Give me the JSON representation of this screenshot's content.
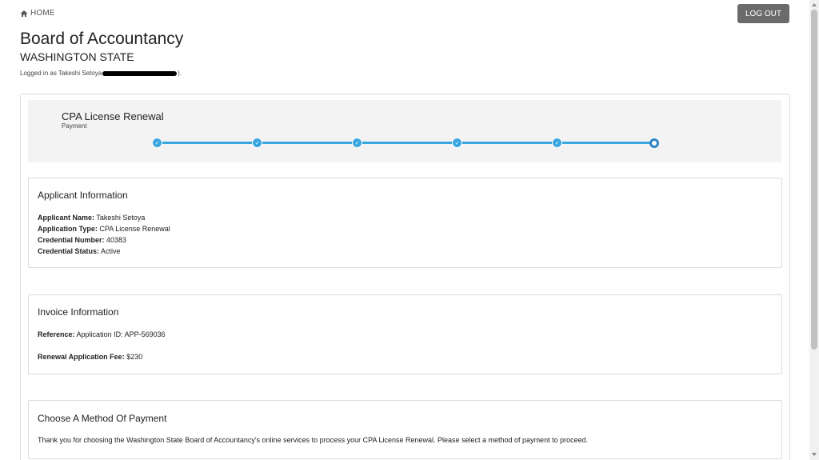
{
  "nav": {
    "home_label": "HOME",
    "logout_label": "LOG OUT"
  },
  "header": {
    "title": "Board of Accountancy",
    "subtitle": "WASHINGTON STATE",
    "logged_in_prefix": "Logged in as Takeshi Setoya",
    "logged_in_suffix": ")."
  },
  "stepper": {
    "title": "CPA License Renewal",
    "current_step": "Payment",
    "steps_total": 6,
    "steps_completed": 5
  },
  "applicant": {
    "heading": "Applicant Information",
    "name_label": "Applicant Name:",
    "name_value": "Takeshi Setoya",
    "type_label": "Application Type:",
    "type_value": "CPA License Renewal",
    "credential_number_label": "Credential Number:",
    "credential_number_value": "40383",
    "credential_status_label": "Credential Status:",
    "credential_status_value": "Active"
  },
  "invoice": {
    "heading": "Invoice Information",
    "reference_label": "Reference:",
    "reference_value": "Application ID: APP-569036",
    "fee_label": "Renewal Application Fee:",
    "fee_value": "$230"
  },
  "payment": {
    "heading": "Choose A Method Of Payment",
    "message": "Thank you for choosing the Washington State Board of Accountancy's online services to process your CPA License Renewal. Please select a method of payment to proceed."
  },
  "colors": {
    "accent": "#3aa6e0",
    "accent_dark": "#2b86c8",
    "logout_bg": "#6b6b6b",
    "panel_bg": "#f3f3f3"
  },
  "icons": {
    "home": "home-icon",
    "check": "check-icon"
  }
}
